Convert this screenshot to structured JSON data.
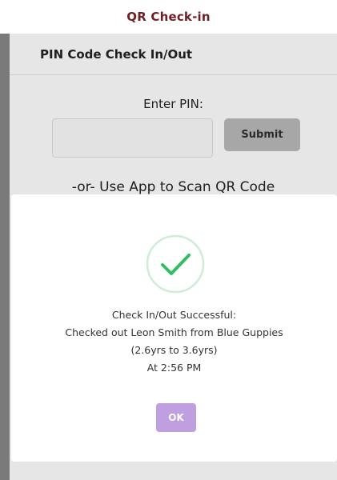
{
  "app": {
    "title": "QR Check-in"
  },
  "background_card": {
    "title": "PIN Code Check In/Out",
    "enter_pin_label": "Enter PIN:",
    "pin_input_value": "",
    "submit_label": "Submit",
    "or_scan_text": "-or- Use App to Scan QR Code"
  },
  "modal": {
    "icon": "check-circle-icon",
    "lines": [
      "Check In/Out Successful:",
      "Checked out Leon Smith from Blue Guppies",
      "(2.6yrs to 3.6yrs)",
      "At 2:56 PM"
    ],
    "ok_label": "OK"
  },
  "colors": {
    "title": "#6e1f24",
    "success_green": "#2fbf5f",
    "success_ring": "#cdeed6",
    "ok_button": "#bf9fe0",
    "overlay": "#7a7a7a",
    "submit_button": "#a7a7a7"
  }
}
